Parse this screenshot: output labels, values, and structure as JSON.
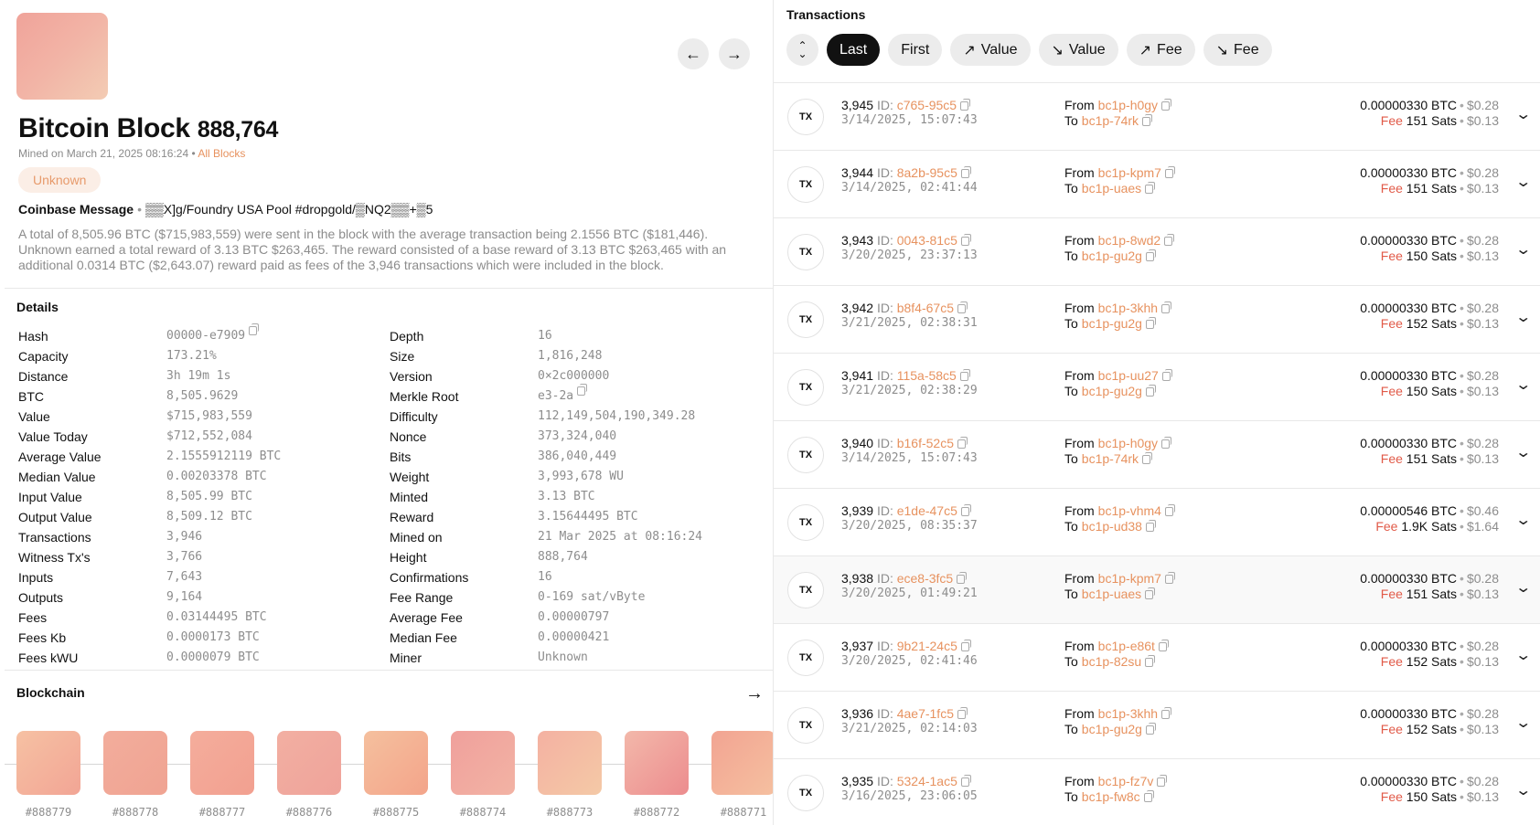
{
  "block": {
    "title": "Bitcoin Block",
    "number": "888,764",
    "mined_text": "Mined on March 21, 2025 08:16:24",
    "all_blocks_link": "All Blocks",
    "miner_badge": "Unknown",
    "coinbase_label": "Coinbase Message",
    "coinbase_message": "▒▒X]g/Foundry USA Pool #dropgold/▒NQ2▒▒+▒5",
    "summary": "A total of 8,505.96 BTC ($715,983,559) were sent in the block with the average transaction being 2.1556 BTC ($181,446). Unknown earned a total reward of 3.13 BTC $263,465. The reward consisted of a base reward of 3.13 BTC $263,465 with an additional 0.0314 BTC ($2,643.07) reward paid as fees of the 3,946 transactions which were included in the block."
  },
  "details": {
    "title": "Details",
    "left": [
      {
        "label": "Hash",
        "value": "00000-e7909",
        "copy": true
      },
      {
        "label": "Capacity",
        "value": "173.21%"
      },
      {
        "label": "Distance",
        "value": "3h 19m 1s"
      },
      {
        "label": "BTC",
        "value": "8,505.9629"
      },
      {
        "label": "Value",
        "value": "$715,983,559"
      },
      {
        "label": "Value Today",
        "value": "$712,552,084"
      },
      {
        "label": "Average Value",
        "value": "2.1555912119 BTC"
      },
      {
        "label": "Median Value",
        "value": "0.00203378 BTC"
      },
      {
        "label": "Input Value",
        "value": "8,505.99 BTC"
      },
      {
        "label": "Output Value",
        "value": "8,509.12 BTC"
      },
      {
        "label": "Transactions",
        "value": "3,946"
      },
      {
        "label": "Witness Tx's",
        "value": "3,766"
      },
      {
        "label": "Inputs",
        "value": "7,643"
      },
      {
        "label": "Outputs",
        "value": "9,164"
      },
      {
        "label": "Fees",
        "value": "0.03144495 BTC"
      },
      {
        "label": "Fees Kb",
        "value": "0.0000173 BTC"
      },
      {
        "label": "Fees kWU",
        "value": "0.0000079 BTC"
      }
    ],
    "right": [
      {
        "label": "Depth",
        "value": "16"
      },
      {
        "label": "Size",
        "value": "1,816,248"
      },
      {
        "label": "Version",
        "value": "0×2c000000"
      },
      {
        "label": "Merkle Root",
        "value": "e3-2a",
        "copy": true
      },
      {
        "label": "Difficulty",
        "value": "112,149,504,190,349.28"
      },
      {
        "label": "Nonce",
        "value": "373,324,040"
      },
      {
        "label": "Bits",
        "value": "386,040,449"
      },
      {
        "label": "Weight",
        "value": "3,993,678 WU"
      },
      {
        "label": "Minted",
        "value": "3.13 BTC"
      },
      {
        "label": "Reward",
        "value": "3.15644495 BTC"
      },
      {
        "label": "Mined on",
        "value": "21 Mar 2025 at 08:16:24"
      },
      {
        "label": "Height",
        "value": "888,764"
      },
      {
        "label": "Confirmations",
        "value": "16"
      },
      {
        "label": "Fee Range",
        "value": "0-169 sat/vByte"
      },
      {
        "label": "Average Fee",
        "value": "0.00000797"
      },
      {
        "label": "Median Fee",
        "value": "0.00000421"
      },
      {
        "label": "Miner",
        "value": "Unknown"
      }
    ]
  },
  "blockchain": {
    "title": "Blockchain",
    "blocks": [
      {
        "label": "#888779",
        "from": "#f6c1a3",
        "to": "#f2a595"
      },
      {
        "label": "#888778",
        "from": "#f2ad9c",
        "to": "#f0a392"
      },
      {
        "label": "#888777",
        "from": "#f4ad9c",
        "to": "#f2a090"
      },
      {
        "label": "#888776",
        "from": "#f2afa2",
        "to": "#efa39a"
      },
      {
        "label": "#888775",
        "from": "#f5c09e",
        "to": "#f3a48a"
      },
      {
        "label": "#888774",
        "from": "#f0a09c",
        "to": "#f2b3a4"
      },
      {
        "label": "#888773",
        "from": "#f4b1a2",
        "to": "#f4c9a6"
      },
      {
        "label": "#888772",
        "from": "#f3b8aa",
        "to": "#ec8c8e"
      },
      {
        "label": "#888771",
        "from": "#f2a492",
        "to": "#f5c0a0"
      }
    ]
  },
  "transactions": {
    "title": "Transactions",
    "filters": [
      {
        "label": "Last",
        "active": true,
        "icon": ""
      },
      {
        "label": "First",
        "active": false,
        "icon": ""
      },
      {
        "label": "Value",
        "active": false,
        "icon": "↗"
      },
      {
        "label": "Value",
        "active": false,
        "icon": "↘"
      },
      {
        "label": "Fee",
        "active": false,
        "icon": "↗"
      },
      {
        "label": "Fee",
        "active": false,
        "icon": "↘"
      }
    ],
    "badge": "TX",
    "id_label": "ID:",
    "from_label": "From",
    "to_label": "To",
    "fee_label": "Fee",
    "rows": [
      {
        "num": "3,945",
        "id": "c765-95c5",
        "date": "3/14/2025, 15:07:43",
        "from": "bc1p-h0gy",
        "to": "bc1p-74rk",
        "amount": "0.00000330 BTC",
        "usd": "$0.28",
        "fee": "151 Sats",
        "fee_usd": "$0.13"
      },
      {
        "num": "3,944",
        "id": "8a2b-95c5",
        "date": "3/14/2025, 02:41:44",
        "from": "bc1p-kpm7",
        "to": "bc1p-uaes",
        "amount": "0.00000330 BTC",
        "usd": "$0.28",
        "fee": "151 Sats",
        "fee_usd": "$0.13"
      },
      {
        "num": "3,943",
        "id": "0043-81c5",
        "date": "3/20/2025, 23:37:13",
        "from": "bc1p-8wd2",
        "to": "bc1p-gu2g",
        "amount": "0.00000330 BTC",
        "usd": "$0.28",
        "fee": "150 Sats",
        "fee_usd": "$0.13"
      },
      {
        "num": "3,942",
        "id": "b8f4-67c5",
        "date": "3/21/2025, 02:38:31",
        "from": "bc1p-3khh",
        "to": "bc1p-gu2g",
        "amount": "0.00000330 BTC",
        "usd": "$0.28",
        "fee": "152 Sats",
        "fee_usd": "$0.13"
      },
      {
        "num": "3,941",
        "id": "115a-58c5",
        "date": "3/21/2025, 02:38:29",
        "from": "bc1p-uu27",
        "to": "bc1p-gu2g",
        "amount": "0.00000330 BTC",
        "usd": "$0.28",
        "fee": "150 Sats",
        "fee_usd": "$0.13"
      },
      {
        "num": "3,940",
        "id": "b16f-52c5",
        "date": "3/14/2025, 15:07:43",
        "from": "bc1p-h0gy",
        "to": "bc1p-74rk",
        "amount": "0.00000330 BTC",
        "usd": "$0.28",
        "fee": "151 Sats",
        "fee_usd": "$0.13"
      },
      {
        "num": "3,939",
        "id": "e1de-47c5",
        "date": "3/20/2025, 08:35:37",
        "from": "bc1p-vhm4",
        "to": "bc1p-ud38",
        "amount": "0.00000546 BTC",
        "usd": "$0.46",
        "fee": "1.9K Sats",
        "fee_usd": "$1.64"
      },
      {
        "num": "3,938",
        "id": "ece8-3fc5",
        "date": "3/20/2025, 01:49:21",
        "from": "bc1p-kpm7",
        "to": "bc1p-uaes",
        "amount": "0.00000330 BTC",
        "usd": "$0.28",
        "fee": "151 Sats",
        "fee_usd": "$0.13",
        "highlight": true
      },
      {
        "num": "3,937",
        "id": "9b21-24c5",
        "date": "3/20/2025, 02:41:46",
        "from": "bc1p-e86t",
        "to": "bc1p-82su",
        "amount": "0.00000330 BTC",
        "usd": "$0.28",
        "fee": "152 Sats",
        "fee_usd": "$0.13"
      },
      {
        "num": "3,936",
        "id": "4ae7-1fc5",
        "date": "3/21/2025, 02:14:03",
        "from": "bc1p-3khh",
        "to": "bc1p-gu2g",
        "amount": "0.00000330 BTC",
        "usd": "$0.28",
        "fee": "152 Sats",
        "fee_usd": "$0.13"
      },
      {
        "num": "3,935",
        "id": "5324-1ac5",
        "date": "3/16/2025, 23:06:05",
        "from": "bc1p-fz7v",
        "to": "bc1p-fw8c",
        "amount": "0.00000330 BTC",
        "usd": "$0.28",
        "fee": "150 Sats",
        "fee_usd": "$0.13"
      }
    ]
  }
}
